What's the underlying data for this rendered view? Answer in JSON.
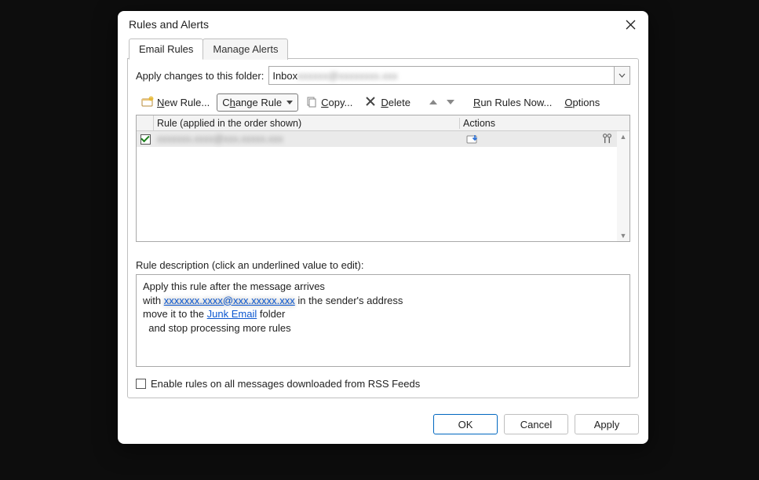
{
  "dialog": {
    "title": "Rules and Alerts"
  },
  "tabs": {
    "email_rules": "Email Rules",
    "manage_alerts": "Manage Alerts"
  },
  "folder": {
    "label": "Apply changes to this folder:",
    "value_visible": "Inbox",
    "value_hidden": " xxxxxx@xxxxxxxx.xxx"
  },
  "toolbar": {
    "new_rule": "New Rule...",
    "change_rule": "Change Rule",
    "copy": "Copy...",
    "delete": "Delete",
    "run_now": "Run Rules Now...",
    "options": "Options"
  },
  "columns": {
    "rule": "Rule (applied in the order shown)",
    "actions": "Actions"
  },
  "rules": [
    {
      "checked": true,
      "name_hidden": "xxxxxxx.xxxx@xxx.xxxxx.xxx"
    }
  ],
  "description": {
    "label": "Rule description (click an underlined value to edit):",
    "line1": "Apply this rule after the message arrives",
    "line2_pre": "with ",
    "line2_link_hidden": "xxxxxxx.xxxx@xxx.xxxxx.xxx",
    "line2_post": " in the sender's address",
    "line3_pre": "move it to the ",
    "line3_link": "Junk Email",
    "line3_post": " folder",
    "line4": "  and stop processing more rules"
  },
  "rss": {
    "label": "Enable rules on all messages downloaded from RSS Feeds",
    "checked": false
  },
  "buttons": {
    "ok": "OK",
    "cancel": "Cancel",
    "apply": "Apply"
  }
}
